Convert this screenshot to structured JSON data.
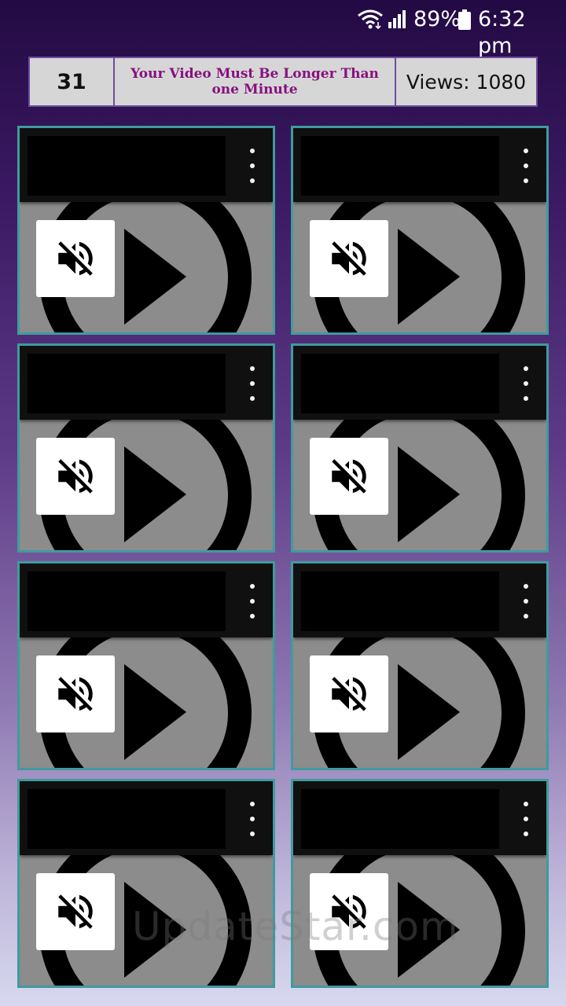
{
  "status_bar": {
    "battery_percent": "89%",
    "time": "6:32 pm",
    "icons": [
      "wifi-icon",
      "signal-icon",
      "battery-icon"
    ]
  },
  "header": {
    "count": "31",
    "notice": "Your Video Must Be Longer Than one Minute",
    "views": "Views: 1080"
  },
  "videos": {
    "card_count": 8,
    "icons": [
      "more-vert-icon",
      "volume-off-icon",
      "play-icon"
    ]
  },
  "watermark": "UpdateStar.com",
  "colors": {
    "notice_text": "#86117f",
    "card_border": "#3f9b9e",
    "header_border": "#6d4d9b"
  }
}
